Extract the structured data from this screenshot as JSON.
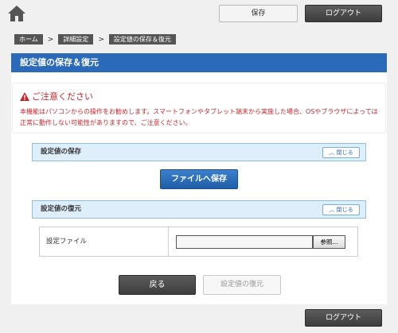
{
  "header": {
    "save_label": "保存",
    "logout_label": "ログアウト"
  },
  "breadcrumb": {
    "items": [
      "ホーム",
      "詳細設定",
      "設定値の保存＆復元"
    ],
    "separator": ">"
  },
  "page": {
    "title": "設定値の保存＆復元"
  },
  "notice": {
    "heading": "ご注意ください",
    "body": "本機能はパソコンからの操作をお勧めします。スマートフォンやタブレット端末から実施した場合、OSやブラウザによっては正常に動作しない可能性がありますので、ご注意ください。"
  },
  "sections": {
    "save": {
      "title": "設定値の保存",
      "collapse_label": "閉じる",
      "button_label": "ファイルへ保存"
    },
    "restore": {
      "title": "設定値の復元",
      "collapse_label": "閉じる",
      "file_label": "設定ファイル",
      "file_value": "",
      "browse_label": "参照..."
    }
  },
  "actions": {
    "back_label": "戻る",
    "restore_label": "設定値の復元"
  },
  "footer": {
    "logout_label": "ログアウト"
  },
  "colors": {
    "accent": "#2a6ab8",
    "warning": "#c2272d",
    "dark_button": "#4a4a4a",
    "section_bg": "#dfeefb"
  },
  "icons": {
    "home": "home-icon",
    "warning": "warning-icon",
    "collapse": "chevron-up-icon"
  }
}
